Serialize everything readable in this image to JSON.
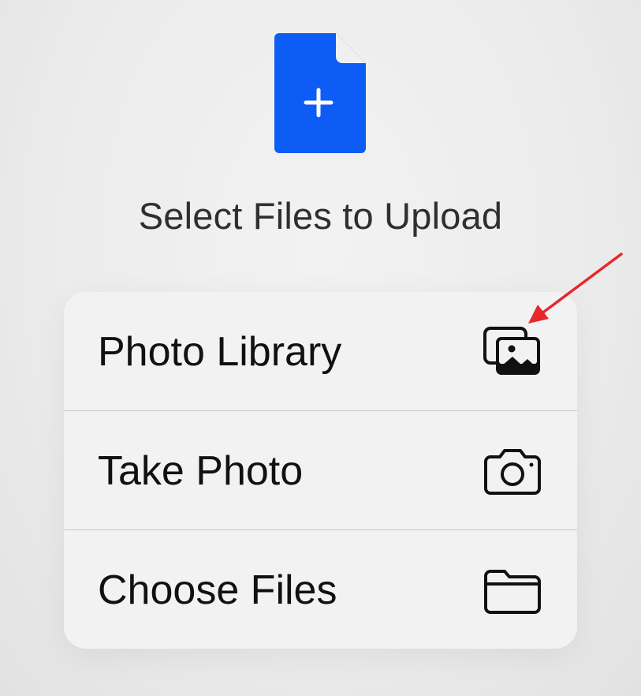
{
  "header": {
    "title": "Select Files to Upload",
    "icon": "file-plus-icon",
    "icon_color": "#0e5cf6"
  },
  "menu": {
    "items": [
      {
        "label": "Photo Library",
        "icon": "photo-library-icon"
      },
      {
        "label": "Take Photo",
        "icon": "camera-icon"
      },
      {
        "label": "Choose Files",
        "icon": "folder-icon"
      }
    ]
  },
  "annotation": {
    "type": "arrow",
    "color": "#e8262b",
    "points_to": "photo-library-icon"
  }
}
